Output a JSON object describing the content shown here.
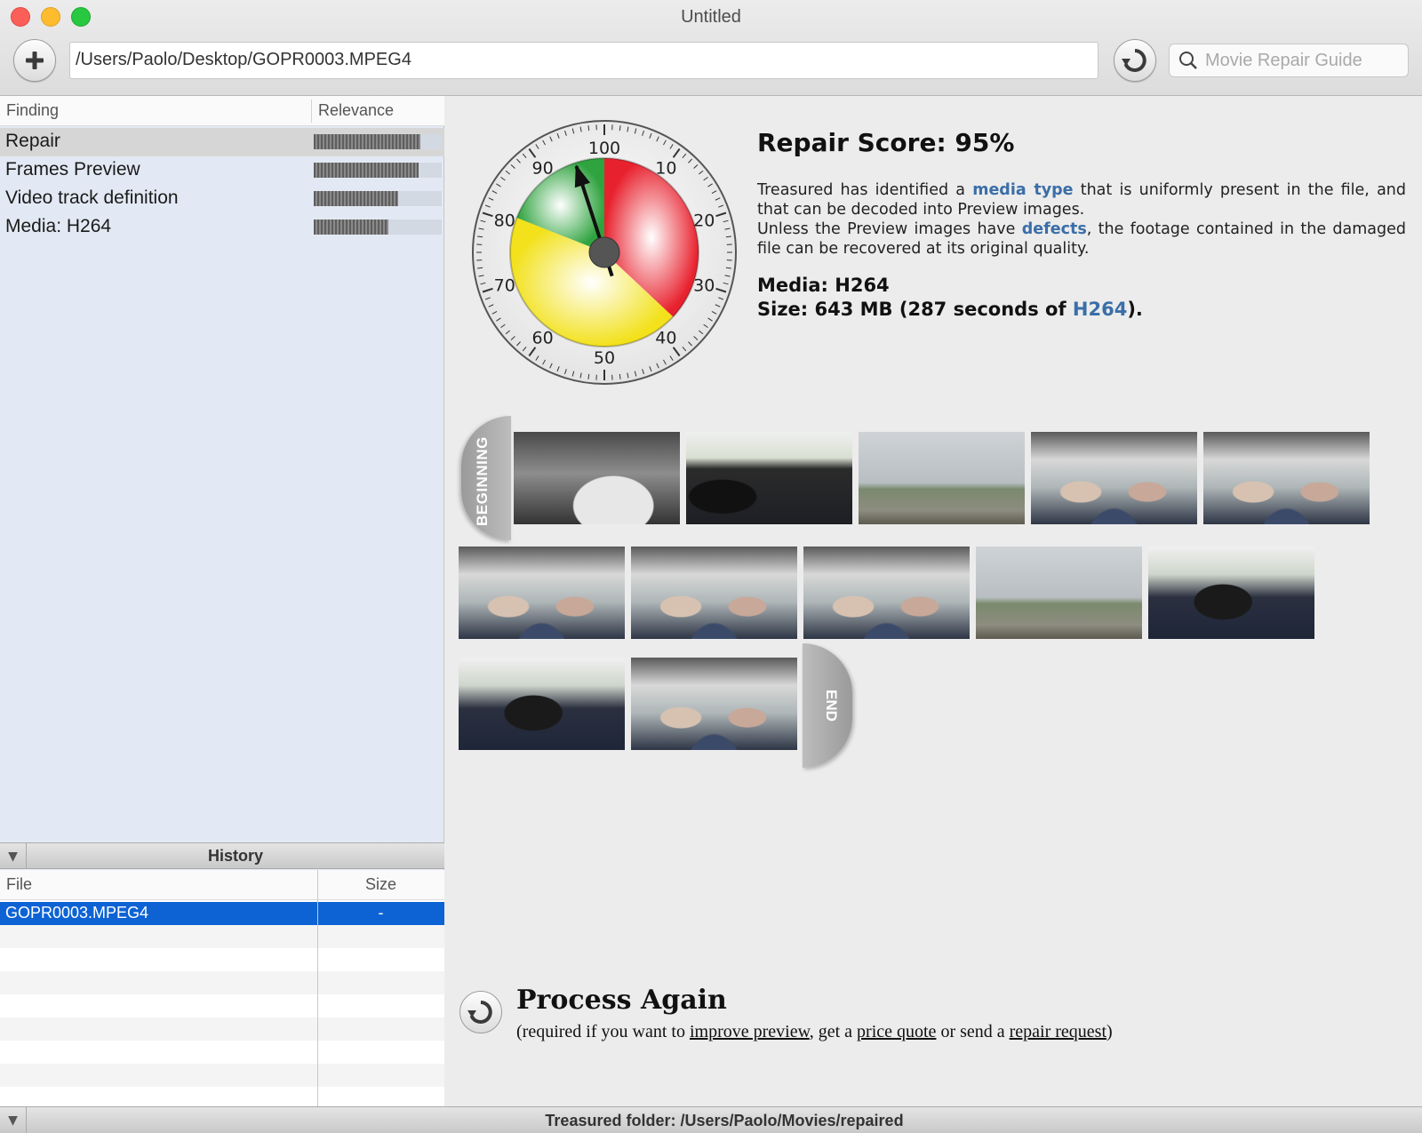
{
  "window": {
    "title": "Untitled"
  },
  "toolbar": {
    "path_value": "/Users/Paolo/Desktop/GOPR0003.MPEG4",
    "search_placeholder": "Movie Repair Guide"
  },
  "findings": {
    "col_finding": "Finding",
    "col_relevance": "Relevance",
    "rows": [
      {
        "label": "Repair",
        "relevance": 0.83
      },
      {
        "label": "Frames Preview",
        "relevance": 0.82
      },
      {
        "label": "Video track definition",
        "relevance": 0.66
      },
      {
        "label": "Media: H264",
        "relevance": 0.58
      }
    ]
  },
  "history": {
    "title": "History",
    "col_file": "File",
    "col_size": "Size",
    "rows": [
      {
        "file": "GOPR0003.MPEG4",
        "size": "-"
      }
    ]
  },
  "gauge": {
    "score": 95,
    "labels": [
      "100",
      "10",
      "20",
      "30",
      "40",
      "50",
      "60",
      "70",
      "80",
      "90"
    ],
    "colors": {
      "red": "#e8212e",
      "yellow": "#f2e11b",
      "green": "#2fa33f"
    }
  },
  "report": {
    "score_title": "Repair Score: 95%",
    "desc_1a": "Treasured has identified a",
    "desc_1_link": "media type",
    "desc_1b": "that is uniformly present in the file, and that can be decoded into Preview images.",
    "desc_2a": "Unless the Preview images have",
    "desc_2_link": "defects",
    "desc_2b": ", the footage contained in the damaged file can be recovered at its original quality.",
    "media_line": "Media: H264",
    "size_a": "Size: 643 MB (287 seconds of",
    "size_link": "H264",
    "size_b": ")."
  },
  "frames": {
    "begin_label": "BEGINNING",
    "end_label": "END"
  },
  "process": {
    "title": "Process Again",
    "sub_a": "(required if you want to",
    "link_improve": "improve preview",
    "sub_b": ", get a",
    "link_quote": "price quote",
    "sub_c": "or send a",
    "link_request": "repair request",
    "sub_d": ")"
  },
  "status": {
    "text": "Treasured folder: /Users/Paolo/Movies/repaired"
  }
}
